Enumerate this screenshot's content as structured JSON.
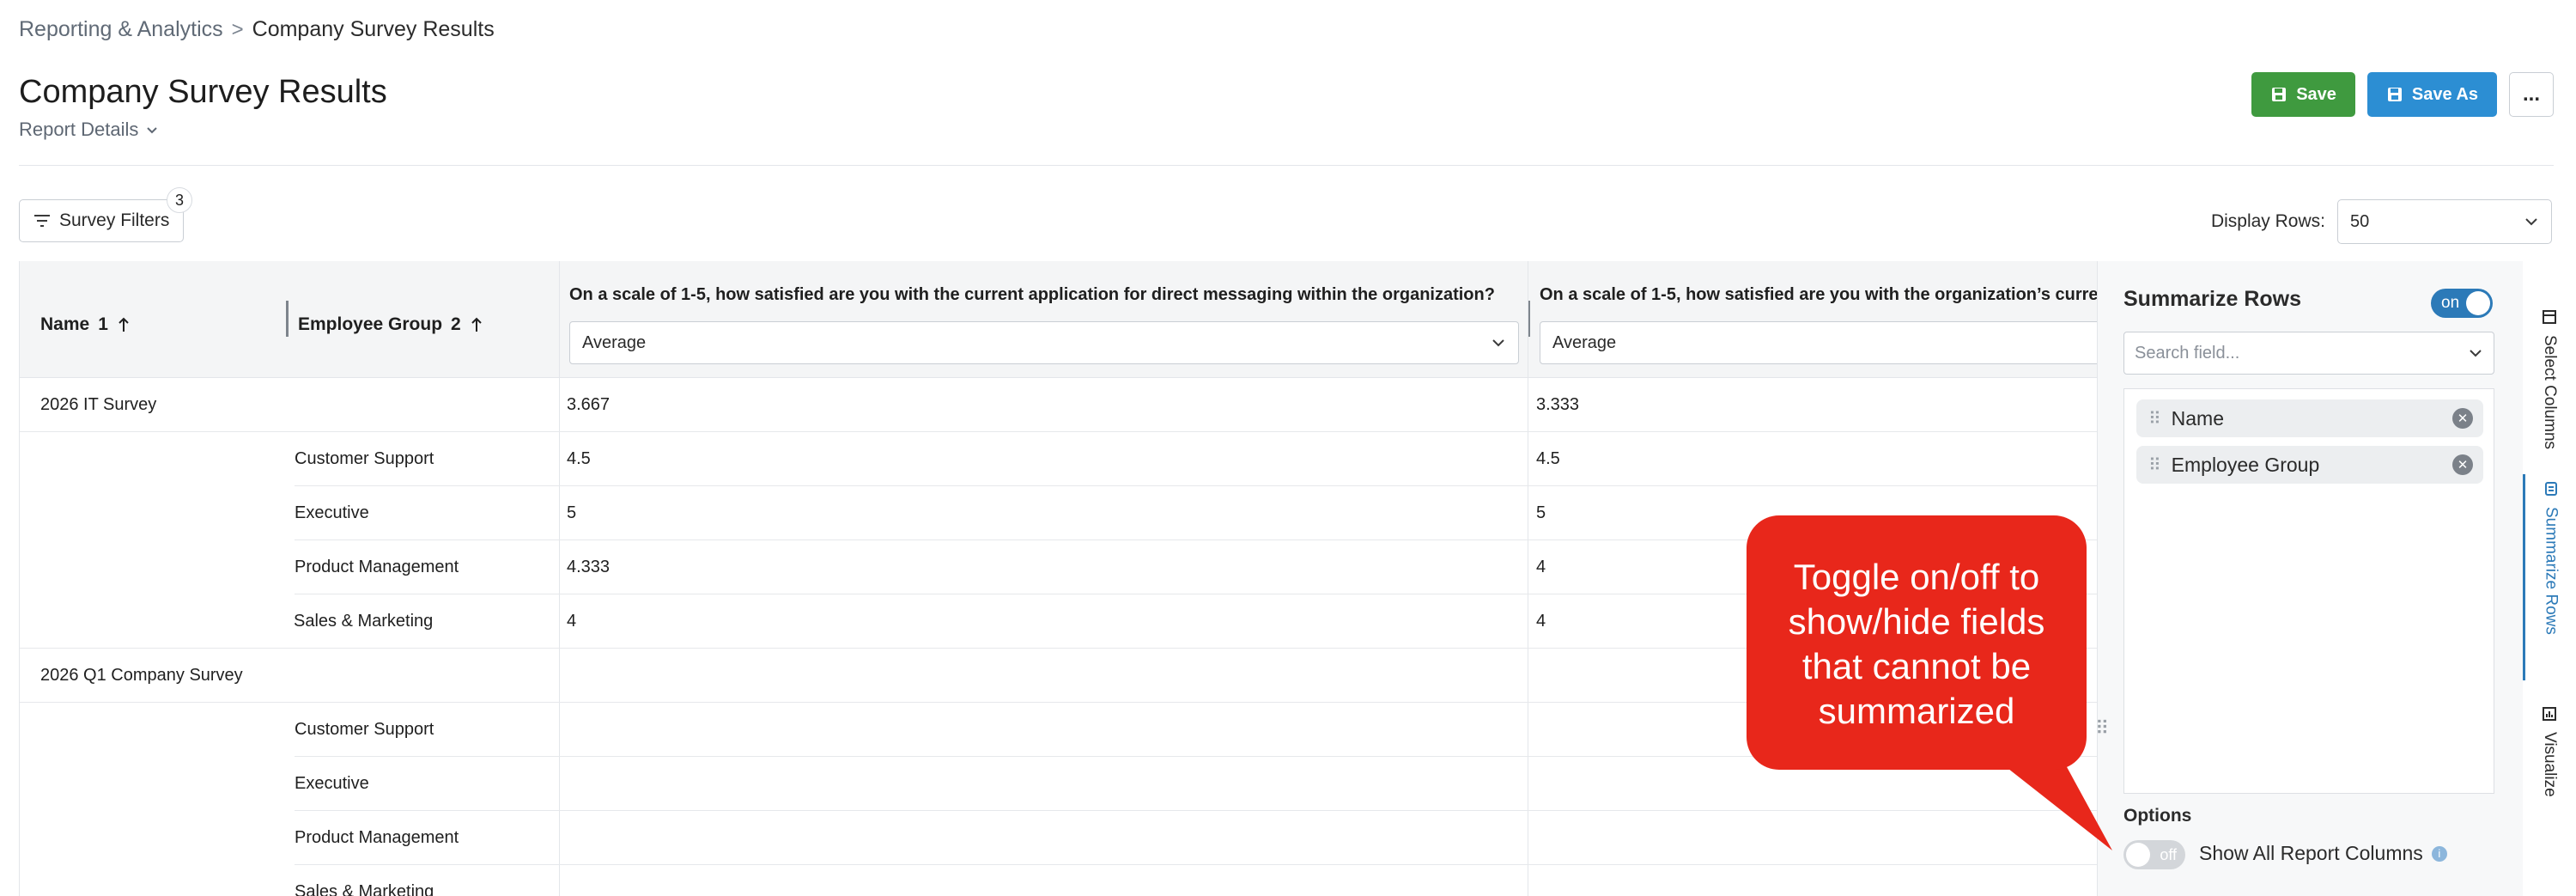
{
  "breadcrumb": {
    "parent": "Reporting & Analytics",
    "separator": ">",
    "current": "Company Survey Results"
  },
  "page": {
    "title": "Company Survey Results",
    "report_details": "Report Details"
  },
  "header_actions": {
    "save": "Save",
    "save_as": "Save As",
    "more": "..."
  },
  "filters": {
    "label": "Survey Filters",
    "count": "3"
  },
  "display_rows": {
    "label": "Display Rows:",
    "value": "50"
  },
  "table": {
    "columns": {
      "name": "Name",
      "name_sort": "1",
      "group": "Employee Group",
      "group_sort": "2",
      "q1": "On a scale of 1-5, how satisfied are you with the current application for direct messaging within the organization?",
      "q1_agg": "Average",
      "q2": "On a scale of 1-5, how satisfied are you with the organization’s curre",
      "q2_agg": "Average"
    },
    "rows": [
      {
        "name": "2026 IT Survey",
        "group": "",
        "q1": "3.667",
        "q2": "3.333"
      },
      {
        "name": "",
        "group": "Customer Support",
        "q1": "4.5",
        "q2": "4.5"
      },
      {
        "name": "",
        "group": "Executive",
        "q1": "5",
        "q2": "5"
      },
      {
        "name": "",
        "group": "Product Management",
        "q1": "4.333",
        "q2": "4"
      },
      {
        "name": "",
        "group": "Sales & Marketing",
        "q1": "4",
        "q2": "4"
      },
      {
        "name": "2026 Q1 Company Survey",
        "group": "",
        "q1": "",
        "q2": ""
      },
      {
        "name": "",
        "group": "Customer Support",
        "q1": "",
        "q2": ""
      },
      {
        "name": "",
        "group": "Executive",
        "q1": "",
        "q2": ""
      },
      {
        "name": "",
        "group": "Product Management",
        "q1": "",
        "q2": ""
      },
      {
        "name": "",
        "group": "Sales & Marketing",
        "q1": "",
        "q2": ""
      }
    ]
  },
  "panel": {
    "title": "Summarize Rows",
    "toggle": "on",
    "search_placeholder": "Search field...",
    "fields": [
      "Name",
      "Employee Group"
    ],
    "options_label": "Options",
    "show_all_toggle": "off",
    "show_all_label": "Show All Report Columns"
  },
  "side_tabs": {
    "select_columns": "Select Columns",
    "summarize_rows": "Summarize Rows",
    "visualize": "Visualize"
  },
  "callout": {
    "line1": "Toggle on/off to",
    "line2": "show/hide fields",
    "line3": "that cannot be",
    "line4": "summarized"
  },
  "colors": {
    "save_green": "#3f9a3f",
    "save_as_blue": "#2c8ed3",
    "accent_blue": "#2c7ab8",
    "callout_red": "#e8271b"
  }
}
